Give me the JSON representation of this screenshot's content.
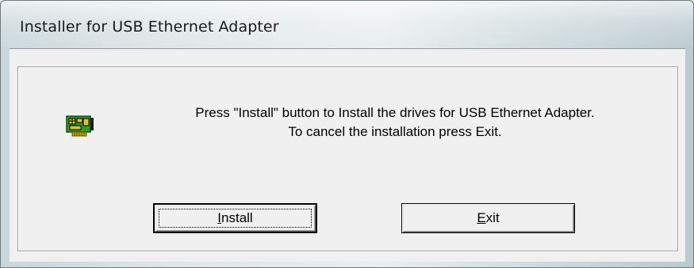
{
  "window": {
    "title": "Installer for USB Ethernet Adapter"
  },
  "icons": {
    "adapter": "network-card-icon"
  },
  "message": {
    "line1": "Press \"Install\" button to Install the drives for USB Ethernet Adapter.",
    "line2": "To cancel the installation press Exit."
  },
  "buttons": {
    "install": {
      "mnemonic": "I",
      "rest": "nstall"
    },
    "exit": {
      "mnemonic": "E",
      "rest": "xit"
    }
  },
  "colors": {
    "board": "#2f9a2f",
    "chip": "#d8c23a",
    "connector": "#c9a400"
  }
}
